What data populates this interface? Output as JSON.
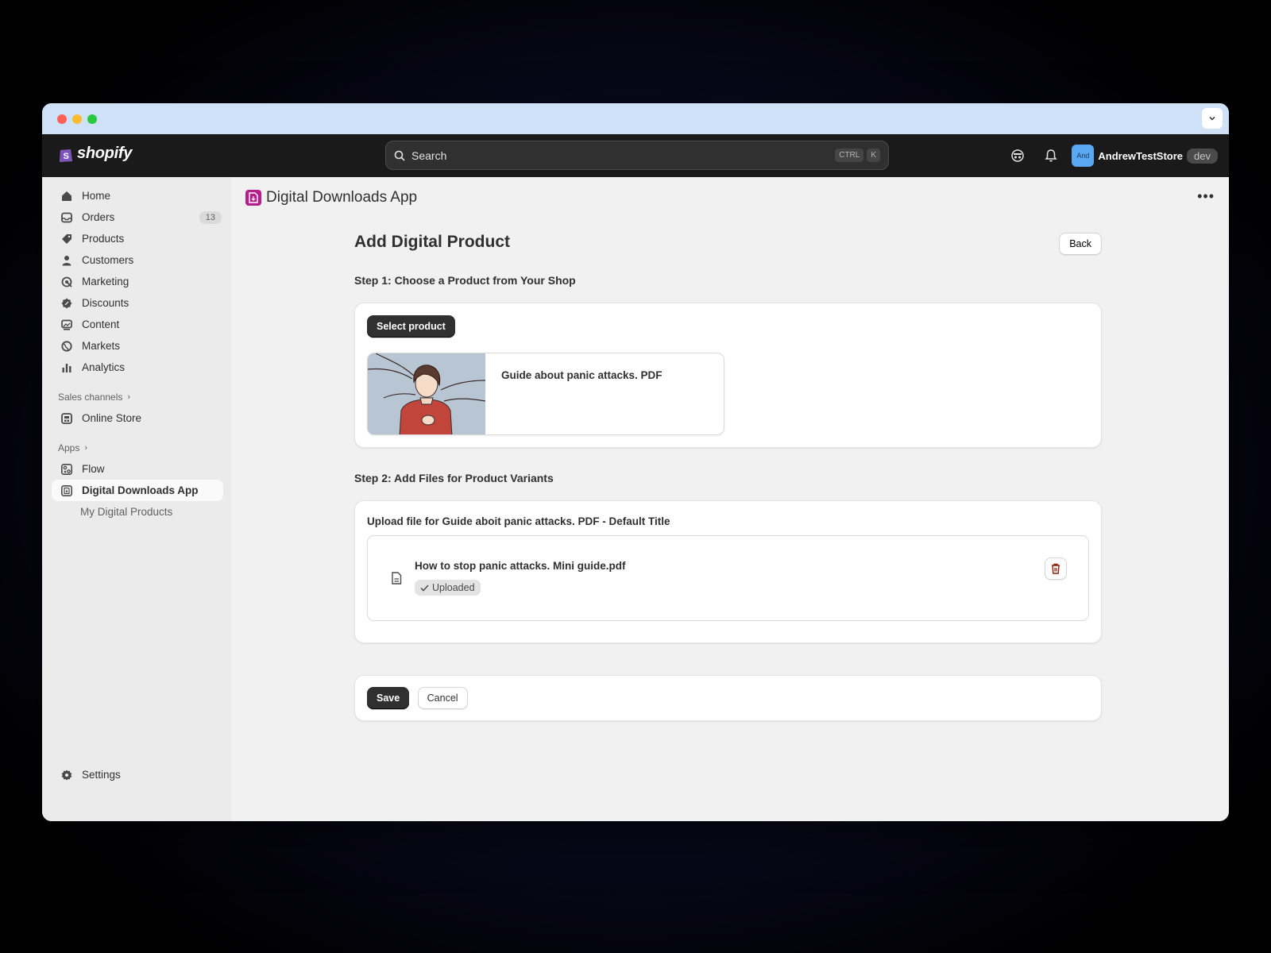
{
  "brand": {
    "name": "shopify"
  },
  "search": {
    "placeholder": "Search",
    "shortcut_1": "CTRL",
    "shortcut_2": "K"
  },
  "account": {
    "avatar_initials": "And",
    "store_name": "AndrewTestStore",
    "env_badge": "dev"
  },
  "sidebar": {
    "items": [
      {
        "label": "Home",
        "icon": "home-icon"
      },
      {
        "label": "Orders",
        "icon": "inbox-icon",
        "badge": "13"
      },
      {
        "label": "Products",
        "icon": "tag-icon"
      },
      {
        "label": "Customers",
        "icon": "person-icon"
      },
      {
        "label": "Marketing",
        "icon": "target-icon"
      },
      {
        "label": "Discounts",
        "icon": "discount-icon"
      },
      {
        "label": "Content",
        "icon": "image-icon"
      },
      {
        "label": "Markets",
        "icon": "globe-icon"
      },
      {
        "label": "Analytics",
        "icon": "bar-chart-icon"
      }
    ],
    "sales_channels_label": "Sales channels",
    "online_store_label": "Online Store",
    "apps_label": "Apps",
    "flow_label": "Flow",
    "digital_downloads_label": "Digital Downloads App",
    "my_digital_products_label": "My Digital Products",
    "settings_label": "Settings"
  },
  "app_header": {
    "title": "Digital Downloads App",
    "more": "•••"
  },
  "page": {
    "title": "Add Digital Product",
    "back_label": "Back",
    "step1_title": "Step 1: Choose a Product from Your Shop",
    "select_product_label": "Select product",
    "product_name": "Guide about panic attacks. PDF",
    "step2_title": "Step 2: Add Files for Product Variants",
    "upload_label": "Upload file for Guide aboit panic attacks. PDF - Default Title",
    "file_name": "How to stop panic attacks. Mini guide.pdf",
    "file_status": "Uploaded",
    "save_label": "Save",
    "cancel_label": "Cancel"
  },
  "colors": {
    "topbar": "#1a1a1a",
    "sidebar": "#ebebeb",
    "primary_button": "#303030",
    "app_icon": "#b51f8c",
    "titlebar": "#cfe1f7"
  }
}
